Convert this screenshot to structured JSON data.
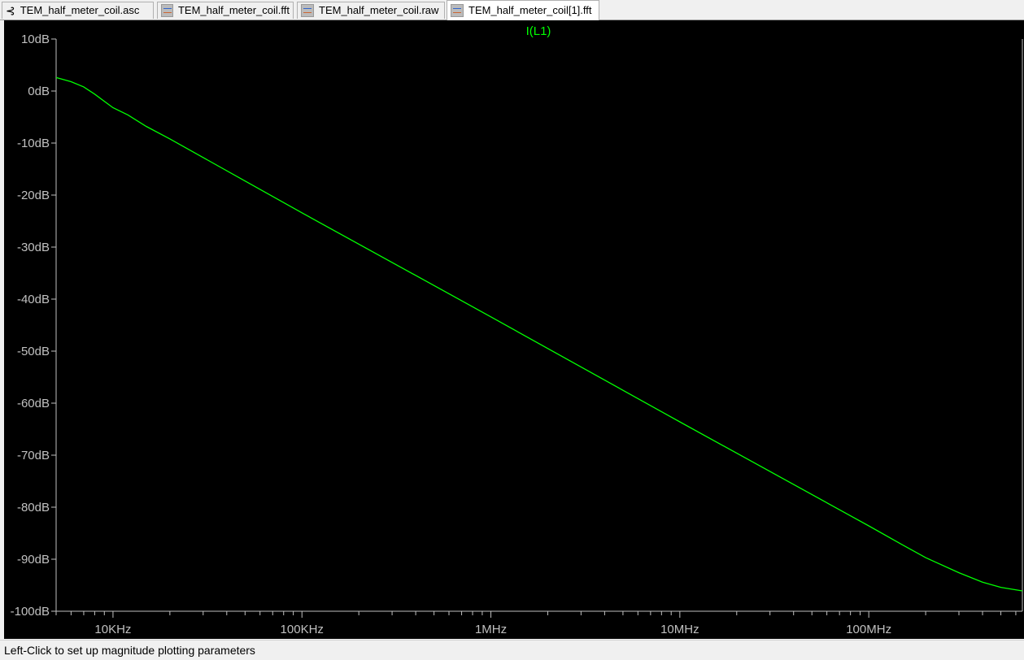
{
  "tabs": [
    {
      "label": "TEM_half_meter_coil.asc",
      "icon": "schematic-icon",
      "active": false
    },
    {
      "label": "TEM_half_meter_coil.fft",
      "icon": "waveform-icon",
      "active": false
    },
    {
      "label": "TEM_half_meter_coil.raw",
      "icon": "waveform-icon",
      "active": false
    },
    {
      "label": "TEM_half_meter_coil[1].fft",
      "icon": "waveform-icon",
      "active": true
    }
  ],
  "status": "Left-Click to set up magnitude plotting parameters",
  "colors": {
    "trace": "#00ff00",
    "axis": "#c0c0c0",
    "background": "#000000"
  },
  "chart_data": {
    "type": "line",
    "title": "I(L1)",
    "xscale": "log",
    "xlim": [
      5000,
      650000000
    ],
    "ylim": [
      -100,
      10
    ],
    "xticks": [
      {
        "v": 10000,
        "label": "10KHz"
      },
      {
        "v": 100000,
        "label": "100KHz"
      },
      {
        "v": 1000000,
        "label": "1MHz"
      },
      {
        "v": 10000000,
        "label": "10MHz"
      },
      {
        "v": 100000000,
        "label": "100MHz"
      }
    ],
    "yticks": [
      {
        "v": 10,
        "label": "10dB"
      },
      {
        "v": 0,
        "label": "0dB"
      },
      {
        "v": -10,
        "label": "-10dB"
      },
      {
        "v": -20,
        "label": "-20dB"
      },
      {
        "v": -30,
        "label": "-30dB"
      },
      {
        "v": -40,
        "label": "-40dB"
      },
      {
        "v": -50,
        "label": "-50dB"
      },
      {
        "v": -60,
        "label": "-60dB"
      },
      {
        "v": -70,
        "label": "-70dB"
      },
      {
        "v": -80,
        "label": "-80dB"
      },
      {
        "v": -90,
        "label": "-90dB"
      },
      {
        "v": -100,
        "label": "-100dB"
      }
    ],
    "series": [
      {
        "name": "I(L1)",
        "x": [
          5000,
          6000,
          7000,
          8000,
          10000,
          12000,
          15000,
          20000,
          50000,
          100000,
          1000000,
          10000000,
          100000000,
          150000000,
          200000000,
          300000000,
          400000000,
          500000000,
          650000000
        ],
        "y": [
          2.6,
          1.8,
          0.8,
          -0.6,
          -3.2,
          -4.6,
          -6.8,
          -9.2,
          -17.3,
          -23.4,
          -43.4,
          -63.6,
          -83.6,
          -87.2,
          -89.7,
          -92.6,
          -94.4,
          -95.4,
          -96.1
        ]
      }
    ]
  }
}
